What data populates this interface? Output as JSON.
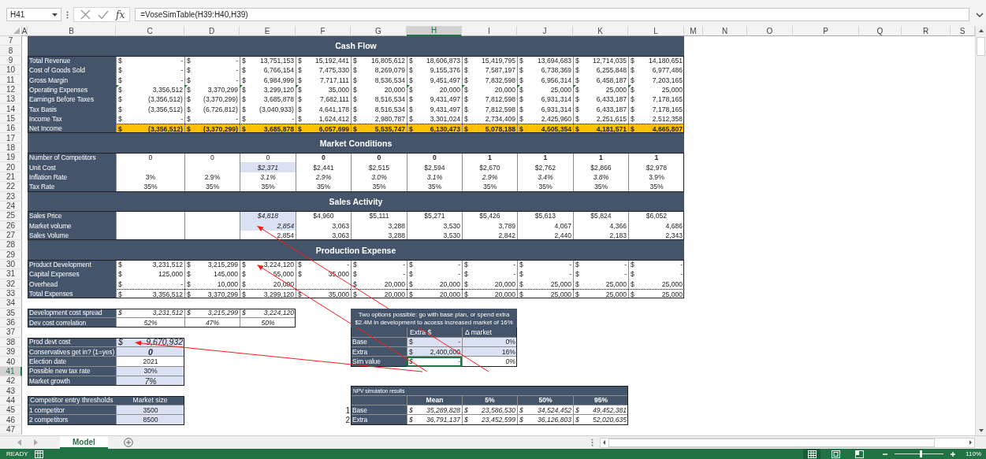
{
  "formula_bar": {
    "name_box": "H41",
    "function_label": "fx",
    "formula": "=VoseSimTable(H39:H40,H39)"
  },
  "columns": [
    {
      "label": "A",
      "selected": false
    },
    {
      "label": "B",
      "selected": false
    },
    {
      "label": "C",
      "selected": false
    },
    {
      "label": "D",
      "selected": false
    },
    {
      "label": "E",
      "selected": false
    },
    {
      "label": "F",
      "selected": false
    },
    {
      "label": "G",
      "selected": false
    },
    {
      "label": "H",
      "selected": true
    },
    {
      "label": "I",
      "selected": false
    },
    {
      "label": "J",
      "selected": false
    },
    {
      "label": "K",
      "selected": false
    },
    {
      "label": "L",
      "selected": false
    },
    {
      "label": "M",
      "selected": false
    },
    {
      "label": "N",
      "selected": false
    },
    {
      "label": "O",
      "selected": false
    },
    {
      "label": "P",
      "selected": false
    },
    {
      "label": "Q",
      "selected": false
    },
    {
      "label": "R",
      "selected": false
    },
    {
      "label": "S",
      "selected": false
    }
  ],
  "row_numbers": [
    {
      "label": "7",
      "selected": false
    },
    {
      "label": "8",
      "selected": false
    },
    {
      "label": "9",
      "selected": false
    },
    {
      "label": "10",
      "selected": false
    },
    {
      "label": "11",
      "selected": false
    },
    {
      "label": "12",
      "selected": false
    },
    {
      "label": "13",
      "selected": false
    },
    {
      "label": "14",
      "selected": false
    },
    {
      "label": "15",
      "selected": false
    },
    {
      "label": "16",
      "selected": false
    },
    {
      "label": "17",
      "selected": false
    },
    {
      "label": "18",
      "selected": false
    },
    {
      "label": "19",
      "selected": false
    },
    {
      "label": "20",
      "selected": false
    },
    {
      "label": "21",
      "selected": false
    },
    {
      "label": "22",
      "selected": false
    },
    {
      "label": "23",
      "selected": false
    },
    {
      "label": "24",
      "selected": false
    },
    {
      "label": "25",
      "selected": false
    },
    {
      "label": "26",
      "selected": false
    },
    {
      "label": "27",
      "selected": false
    },
    {
      "label": "28",
      "selected": false
    },
    {
      "label": "29",
      "selected": false
    },
    {
      "label": "30",
      "selected": false
    },
    {
      "label": "31",
      "selected": false
    },
    {
      "label": "32",
      "selected": false
    },
    {
      "label": "33",
      "selected": false
    },
    {
      "label": "34",
      "selected": false
    },
    {
      "label": "35",
      "selected": false
    },
    {
      "label": "36",
      "selected": false
    },
    {
      "label": "37",
      "selected": false
    },
    {
      "label": "38",
      "selected": false
    },
    {
      "label": "39",
      "selected": false
    },
    {
      "label": "40",
      "selected": false
    },
    {
      "label": "41",
      "selected": true
    },
    {
      "label": "42",
      "selected": false
    },
    {
      "label": "43",
      "selected": false
    },
    {
      "label": "44",
      "selected": false
    },
    {
      "label": "45",
      "selected": false
    },
    {
      "label": "46",
      "selected": false
    },
    {
      "label": "47",
      "selected": false
    }
  ],
  "main_table": {
    "sections": [
      {
        "title": "Cash Flow",
        "rows": [
          {
            "label": "Total Revenue",
            "kind": "money",
            "cells": [
              {
                "sign": "$",
                "value": "-"
              },
              {
                "sign": "$",
                "value": "-"
              },
              {
                "sign": "$",
                "value": "13,751,153"
              },
              {
                "sign": "$",
                "value": "15,192,441"
              },
              {
                "sign": "$",
                "value": "16,805,612"
              },
              {
                "sign": "$",
                "value": "18,606,873"
              },
              {
                "sign": "$",
                "value": "15,419,795"
              },
              {
                "sign": "$",
                "value": "13,694,683"
              },
              {
                "sign": "$",
                "value": "12,714,035"
              },
              {
                "sign": "$",
                "value": "14,180,651"
              }
            ]
          },
          {
            "label": "Cost of Goods Sold",
            "kind": "money",
            "cells": [
              {
                "sign": "$",
                "value": "-"
              },
              {
                "sign": "$",
                "value": "-"
              },
              {
                "sign": "$",
                "value": "6,766,154"
              },
              {
                "sign": "$",
                "value": "7,475,330"
              },
              {
                "sign": "$",
                "value": "8,269,079"
              },
              {
                "sign": "$",
                "value": "9,155,376"
              },
              {
                "sign": "$",
                "value": "7,587,197"
              },
              {
                "sign": "$",
                "value": "6,738,369"
              },
              {
                "sign": "$",
                "value": "6,255,848"
              },
              {
                "sign": "$",
                "value": "6,977,486"
              }
            ]
          },
          {
            "label": "Gross Margin",
            "kind": "money",
            "cells": [
              {
                "sign": "$",
                "value": "-"
              },
              {
                "sign": "$",
                "value": "-"
              },
              {
                "sign": "$",
                "value": "6,984,999"
              },
              {
                "sign": "$",
                "value": "7,717,111"
              },
              {
                "sign": "$",
                "value": "8,536,534"
              },
              {
                "sign": "$",
                "value": "9,451,497"
              },
              {
                "sign": "$",
                "value": "7,832,598"
              },
              {
                "sign": "$",
                "value": "6,956,314"
              },
              {
                "sign": "$",
                "value": "6,458,187"
              },
              {
                "sign": "$",
                "value": "7,203,165"
              }
            ]
          },
          {
            "label": "Operating Expenses",
            "kind": "money",
            "cells": [
              {
                "sign": "$",
                "value": "3,356,512",
                "flag": true
              },
              {
                "sign": "$",
                "value": "3,370,299",
                "flag": true
              },
              {
                "sign": "$",
                "value": "3,299,120",
                "flag": true
              },
              {
                "sign": "$",
                "value": "35,000",
                "flag": true
              },
              {
                "sign": "$",
                "value": "20,000"
              },
              {
                "sign": "$",
                "value": "20,000",
                "flag": true
              },
              {
                "sign": "$",
                "value": "20,000",
                "flag": true
              },
              {
                "sign": "$",
                "value": "25,000",
                "flag": true
              },
              {
                "sign": "$",
                "value": "25,000",
                "flag": true
              },
              {
                "sign": "$",
                "value": "25,000",
                "flag": true
              }
            ]
          },
          {
            "label": "Earnings Before Taxes",
            "kind": "money",
            "cells": [
              {
                "sign": "$",
                "value": "(3,356,512)"
              },
              {
                "sign": "$",
                "value": "(3,370,299)"
              },
              {
                "sign": "$",
                "value": "3,685,878"
              },
              {
                "sign": "$",
                "value": "7,682,111"
              },
              {
                "sign": "$",
                "value": "8,516,534"
              },
              {
                "sign": "$",
                "value": "9,431,497"
              },
              {
                "sign": "$",
                "value": "7,812,598"
              },
              {
                "sign": "$",
                "value": "6,931,314"
              },
              {
                "sign": "$",
                "value": "6,433,187"
              },
              {
                "sign": "$",
                "value": "7,178,165"
              }
            ]
          },
          {
            "label": "Tax Basis",
            "kind": "money",
            "cells": [
              {
                "sign": "$",
                "value": "(3,356,512)"
              },
              {
                "sign": "$",
                "value": "(6,726,812)"
              },
              {
                "sign": "$",
                "value": "(3,040,933)"
              },
              {
                "sign": "$",
                "value": "4,641,178"
              },
              {
                "sign": "$",
                "value": "8,516,534"
              },
              {
                "sign": "$",
                "value": "9,431,497"
              },
              {
                "sign": "$",
                "value": "7,812,598"
              },
              {
                "sign": "$",
                "value": "6,931,314"
              },
              {
                "sign": "$",
                "value": "6,433,187"
              },
              {
                "sign": "$",
                "value": "7,178,165"
              }
            ]
          },
          {
            "label": "Income Tax",
            "kind": "money",
            "cells": [
              {
                "sign": "$",
                "value": "-"
              },
              {
                "sign": "$",
                "value": "-"
              },
              {
                "sign": "$",
                "value": "-"
              },
              {
                "sign": "$",
                "value": "1,624,412"
              },
              {
                "sign": "$",
                "value": "2,980,787"
              },
              {
                "sign": "$",
                "value": "3,301,024"
              },
              {
                "sign": "$",
                "value": "2,734,409"
              },
              {
                "sign": "$",
                "value": "2,425,960"
              },
              {
                "sign": "$",
                "value": "2,251,615"
              },
              {
                "sign": "$",
                "value": "2,512,358"
              }
            ]
          },
          {
            "label": "Net Income",
            "kind": "net",
            "cells": [
              {
                "sign": "$",
                "value": "(3,356,512)"
              },
              {
                "sign": "$",
                "value": "(3,370,299)"
              },
              {
                "sign": "$",
                "value": "3,685,878"
              },
              {
                "sign": "$",
                "value": "6,057,699"
              },
              {
                "sign": "$",
                "value": "5,535,747"
              },
              {
                "sign": "$",
                "value": "6,130,473"
              },
              {
                "sign": "$",
                "value": "5,078,188"
              },
              {
                "sign": "$",
                "value": "4,505,354"
              },
              {
                "sign": "$",
                "value": "4,181,571"
              },
              {
                "sign": "$",
                "value": "4,665,807"
              }
            ]
          }
        ]
      },
      {
        "title": "Market Conditions",
        "rows": [
          {
            "label": "Number of Competitors",
            "kind": "center",
            "cells": [
              {
                "value": "0"
              },
              {
                "value": "0"
              },
              {
                "value": "0"
              },
              {
                "value": "0",
                "bold": true
              },
              {
                "value": "0",
                "bold": true
              },
              {
                "value": "0",
                "bold": true
              },
              {
                "value": "1",
                "bold": true
              },
              {
                "value": "1",
                "bold": true
              },
              {
                "value": "1",
                "bold": true
              },
              {
                "value": "1",
                "bold": true
              }
            ]
          },
          {
            "label": "Unit Cost",
            "kind": "center",
            "cells": [
              null,
              null,
              {
                "value": "$2,371",
                "italic": true,
                "input": true
              },
              {
                "value": "$2,441"
              },
              {
                "value": "$2,515"
              },
              {
                "value": "$2,594"
              },
              {
                "value": "$2,670"
              },
              {
                "value": "$2,762"
              },
              {
                "value": "$2,866"
              },
              {
                "value": "$2,978"
              }
            ]
          },
          {
            "label": "Inflation Rate",
            "kind": "center",
            "cells": [
              {
                "value": "3%"
              },
              {
                "value": "2.9%"
              },
              {
                "value": "3.1%",
                "italic": true
              },
              {
                "value": "2.9%",
                "italic": true
              },
              {
                "value": "3.0%",
                "italic": true
              },
              {
                "value": "3.1%",
                "italic": true
              },
              {
                "value": "2.9%",
                "italic": true
              },
              {
                "value": "3.4%",
                "italic": true
              },
              {
                "value": "3.8%",
                "italic": true
              },
              {
                "value": "3.9%"
              }
            ]
          },
          {
            "label": "Tax Rate",
            "kind": "center",
            "cells": [
              {
                "value": "35%"
              },
              {
                "value": "35%"
              },
              {
                "value": "35%"
              },
              {
                "value": "35%"
              },
              {
                "value": "35%"
              },
              {
                "value": "35%"
              },
              {
                "value": "35%"
              },
              {
                "value": "35%"
              },
              {
                "value": "35%"
              },
              {
                "value": "35%"
              }
            ]
          }
        ]
      },
      {
        "title": "Sales Activity",
        "rows": [
          {
            "label": "Sales Price",
            "kind": "center",
            "cells": [
              null,
              null,
              {
                "value": "$4,818",
                "italic": true,
                "input": true
              },
              {
                "value": "$4,960"
              },
              {
                "value": "$5,111"
              },
              {
                "value": "$5,271"
              },
              {
                "value": "$5,426"
              },
              {
                "value": "$5,613"
              },
              {
                "value": "$5,824"
              },
              {
                "value": "$6,052"
              }
            ]
          },
          {
            "label": "Market volume",
            "kind": "right",
            "cells": [
              null,
              null,
              {
                "value": "2,854",
                "italic": true,
                "input": true
              },
              {
                "value": "3,063"
              },
              {
                "value": "3,288"
              },
              {
                "value": "3,530"
              },
              {
                "value": "3,789"
              },
              {
                "value": "4,067"
              },
              {
                "value": "4,366"
              },
              {
                "value": "4,686"
              }
            ]
          },
          {
            "label": "Sales Volume",
            "kind": "right",
            "cells": [
              null,
              null,
              {
                "value": "2,854"
              },
              {
                "value": "3,063"
              },
              {
                "value": "3,288"
              },
              {
                "value": "3,530"
              },
              {
                "value": "2,842"
              },
              {
                "value": "2,440"
              },
              {
                "value": "2,183"
              },
              {
                "value": "2,343"
              }
            ]
          }
        ]
      },
      {
        "title": "Production Expense",
        "rows": [
          {
            "label": "Product Development",
            "kind": "money",
            "cells": [
              {
                "sign": "$",
                "value": "3,231,512"
              },
              {
                "sign": "$",
                "value": "3,215,299"
              },
              {
                "sign": "$",
                "value": "3,224,120"
              },
              {
                "sign": "$",
                "value": "-"
              },
              {
                "sign": "$",
                "value": "-"
              },
              {
                "sign": "$",
                "value": "-"
              },
              {
                "sign": "$",
                "value": "-"
              },
              {
                "sign": "$",
                "value": "-"
              },
              {
                "sign": "$",
                "value": "-"
              },
              {
                "sign": "$",
                "value": "-"
              }
            ]
          },
          {
            "label": "Capital Expenses",
            "kind": "money",
            "cells": [
              {
                "sign": "$",
                "value": "125,000"
              },
              {
                "sign": "$",
                "value": "145,000"
              },
              {
                "sign": "$",
                "value": "55,000"
              },
              {
                "sign": "$",
                "value": "35,000"
              },
              {
                "sign": "$",
                "value": "-"
              },
              {
                "sign": "$",
                "value": "-"
              },
              {
                "sign": "$",
                "value": "-"
              },
              {
                "sign": "$",
                "value": "-"
              },
              {
                "sign": "$",
                "value": "-"
              },
              {
                "sign": "$",
                "value": "-"
              }
            ]
          },
          {
            "label": "Overhead",
            "kind": "money",
            "cells": [
              {
                "sign": "$",
                "value": "-"
              },
              {
                "sign": "$",
                "value": "10,000"
              },
              {
                "sign": "$",
                "value": "20,000"
              },
              null,
              {
                "sign": "$",
                "value": "20,000"
              },
              {
                "sign": "$",
                "value": "20,000"
              },
              {
                "sign": "$",
                "value": "20,000"
              },
              {
                "sign": "$",
                "value": "25,000"
              },
              {
                "sign": "$",
                "value": "25,000"
              },
              {
                "sign": "$",
                "value": "25,000"
              }
            ]
          },
          {
            "label": "Total Expenses",
            "kind": "sum",
            "cells": [
              {
                "sign": "$",
                "value": "3,356,512"
              },
              {
                "sign": "$",
                "value": "3,370,299"
              },
              {
                "sign": "$",
                "value": "3,299,120"
              },
              {
                "sign": "$",
                "value": "35,000"
              },
              {
                "sign": "$",
                "value": "20,000"
              },
              {
                "sign": "$",
                "value": "20,000"
              },
              {
                "sign": "$",
                "value": "20,000"
              },
              {
                "sign": "$",
                "value": "25,000"
              },
              {
                "sign": "$",
                "value": "25,000"
              },
              {
                "sign": "$",
                "value": "25,000"
              }
            ]
          }
        ]
      }
    ]
  },
  "dev_cost_table": {
    "rows": [
      {
        "label": "Development cost spread",
        "kind": "money",
        "cells": [
          {
            "sign": "$",
            "value": "3,231,512",
            "italic": true
          },
          {
            "sign": "$",
            "value": "3,215,299",
            "italic": true
          },
          {
            "sign": "$",
            "value": "3,224,120",
            "italic": true
          }
        ]
      },
      {
        "label": "Dev cost correlation",
        "kind": "center",
        "cells": [
          {
            "value": "52%",
            "italic": true
          },
          {
            "value": "47%",
            "italic": true
          },
          {
            "value": "50%",
            "italic": true
          }
        ]
      }
    ]
  },
  "inputs_table": {
    "rows": [
      {
        "label": "Prod devt cost",
        "kind": "money",
        "cells": [
          {
            "sign": "$",
            "value": "9,670,932",
            "italic": true,
            "input": true,
            "large": true
          }
        ]
      },
      {
        "label": "Conservatives get in? (1=yes)",
        "kind": "center",
        "cells": [
          {
            "value": "0",
            "italic": true,
            "bold": true,
            "input": true,
            "large": true
          }
        ]
      },
      {
        "label": "Election date",
        "kind": "center",
        "cells": [
          {
            "value": "2021"
          }
        ]
      },
      {
        "label": "Possible new tax rate",
        "kind": "center",
        "cells": [
          {
            "value": "30%",
            "input": true
          }
        ]
      },
      {
        "label": "Market growth",
        "kind": "center",
        "cells": [
          {
            "value": "7%",
            "italic": true,
            "input": true,
            "large": true
          }
        ]
      }
    ]
  },
  "competitor_table": {
    "headers": [
      "Competitor entry thresholds",
      "Market size"
    ],
    "rows": [
      {
        "label": "1 competitor",
        "kind": "center",
        "cells": [
          {
            "value": "3500",
            "input": true
          }
        ]
      },
      {
        "label": "2 competitors",
        "kind": "center",
        "cells": [
          {
            "value": "8500",
            "input": true
          }
        ]
      }
    ]
  },
  "options_table": {
    "note": "Two options possible: go with base plan, or spend extra $2.4M in development to access increased market of 16%",
    "headers": [
      "Extra $",
      "Δ market"
    ],
    "rows": [
      {
        "label": "Base",
        "cells": [
          {
            "sign": "$",
            "value": "-",
            "input": true,
            "selected": false
          },
          {
            "value": "0%",
            "input": true,
            "selected": false
          }
        ]
      },
      {
        "label": "Extra",
        "cells": [
          {
            "sign": "$",
            "value": "2,400,000",
            "input": true,
            "selected": false
          },
          {
            "value": "16%",
            "input": true,
            "selected": false
          }
        ]
      },
      {
        "label": "Sim value",
        "cells": [
          {
            "sign": "$",
            "value": "-",
            "italic": true,
            "selected": true
          },
          {
            "value": "0%",
            "italic": true,
            "selected": false
          }
        ]
      }
    ]
  },
  "npv_table": {
    "title": "NPV simulation results",
    "headers": [
      "Mean",
      "5%",
      "50%",
      "95%"
    ],
    "rows": [
      {
        "number": "1",
        "label": "Base",
        "cells": [
          {
            "sign": "$",
            "value": "35,289,828",
            "italic": true
          },
          {
            "sign": "$",
            "value": "23,586,530",
            "italic": true
          },
          {
            "sign": "$",
            "value": "34,524,452",
            "italic": true
          },
          {
            "sign": "$",
            "value": "49,452,381",
            "italic": true
          }
        ]
      },
      {
        "number": "2",
        "label": "Extra",
        "cells": [
          {
            "sign": "$",
            "value": "36,791,137",
            "italic": true
          },
          {
            "sign": "$",
            "value": "23,452,599",
            "italic": true
          },
          {
            "sign": "$",
            "value": "36,126,803",
            "italic": true
          },
          {
            "sign": "$",
            "value": "52,020,635",
            "italic": true
          }
        ]
      }
    ]
  },
  "sheet_tabs": [
    {
      "label": "Model",
      "selected": true
    }
  ],
  "status_bar": {
    "status": "READY",
    "views": [
      {
        "kind": "normal",
        "selected": true
      },
      {
        "kind": "page-layout",
        "selected": false
      },
      {
        "kind": "page-break",
        "selected": false
      }
    ],
    "zoom": {
      "level": 0.52,
      "label": "110%"
    }
  }
}
